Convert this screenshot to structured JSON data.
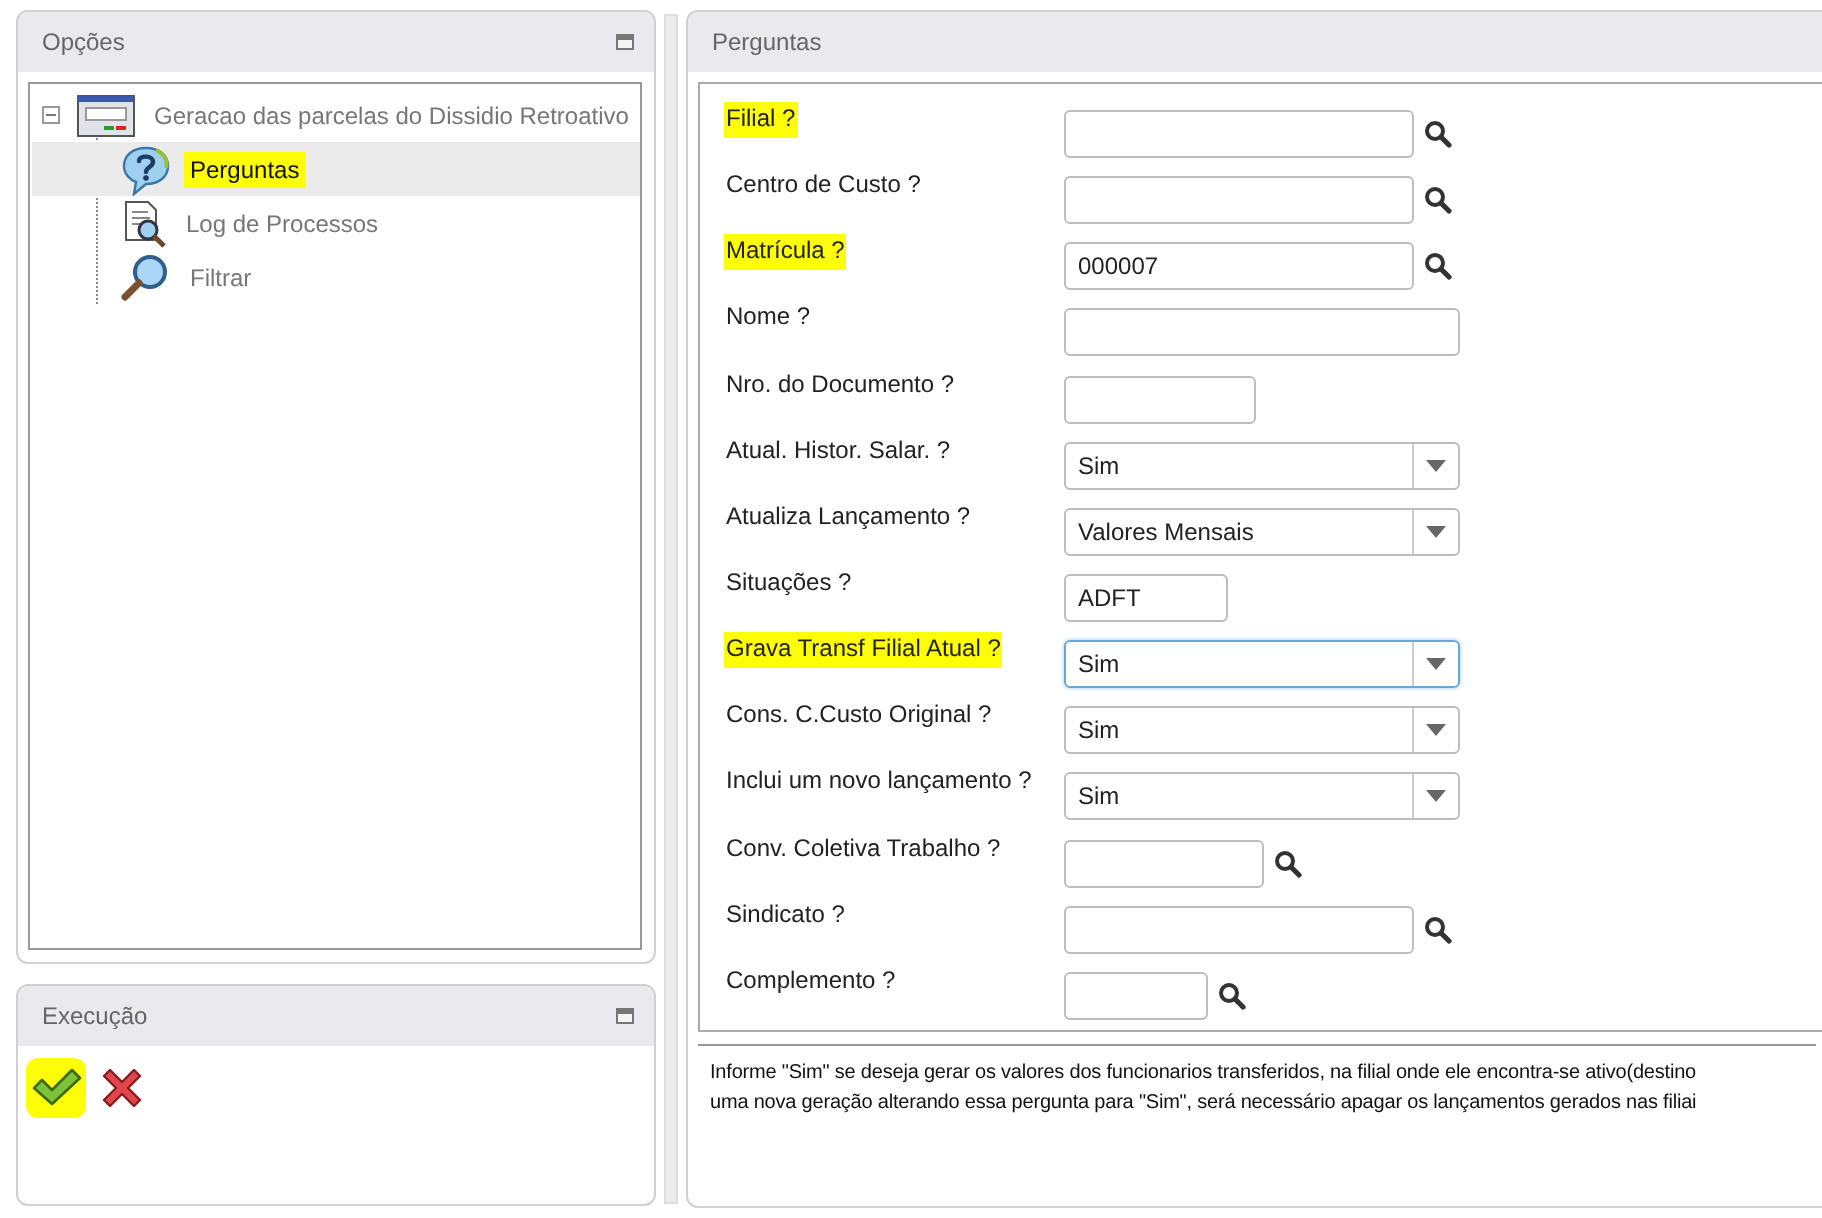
{
  "options_panel": {
    "title": "Opções",
    "tree": [
      {
        "label": "Geracao das parcelas do Dissidio Retroativo",
        "kind": "process",
        "expanded": true,
        "selected": false,
        "highlighted": false,
        "children": [
          {
            "label": "Perguntas",
            "kind": "questions",
            "selected": true,
            "highlighted": true
          },
          {
            "label": "Log de Processos",
            "kind": "log",
            "selected": false,
            "highlighted": false
          },
          {
            "label": "Filtrar",
            "kind": "filter",
            "selected": false,
            "highlighted": false
          }
        ]
      }
    ]
  },
  "execution_panel": {
    "title": "Execução",
    "buttons": [
      {
        "kind": "confirm",
        "highlighted": true
      },
      {
        "kind": "cancel",
        "highlighted": false
      }
    ]
  },
  "questions_panel": {
    "title": "Perguntas",
    "fields": [
      {
        "label": "Filial ?",
        "kind": "lookup",
        "highlighted": true,
        "focused": false
      },
      {
        "label": "Centro de Custo ?",
        "kind": "lookup",
        "highlighted": false,
        "focused": false
      },
      {
        "label": "Matrícula ?",
        "kind": "lookup",
        "value": "000007",
        "highlighted": true,
        "focused": false
      },
      {
        "label": "Nome ?",
        "kind": "text",
        "highlighted": false,
        "focused": false
      },
      {
        "label": "Nro. do Documento ?",
        "kind": "text",
        "highlighted": false,
        "focused": false
      },
      {
        "label": "Atual. Histor. Salar. ?",
        "kind": "combo",
        "value": "Sim",
        "highlighted": false,
        "focused": false
      },
      {
        "label": "Atualiza Lançamento ?",
        "kind": "combo",
        "value": "Valores Mensais",
        "highlighted": false,
        "focused": false
      },
      {
        "label": "Situações ?",
        "kind": "text",
        "value": "ADFT",
        "highlighted": false,
        "focused": false
      },
      {
        "label": "Grava Transf Filial Atual ?",
        "kind": "combo",
        "value": "Sim",
        "highlighted": true,
        "focused": true
      },
      {
        "label": "Cons. C.Custo Original ?",
        "kind": "combo",
        "value": "Sim",
        "highlighted": false,
        "focused": false
      },
      {
        "label": "Inclui um novo lançamento ?",
        "kind": "combo",
        "value": "Sim",
        "highlighted": false,
        "focused": false
      },
      {
        "label": "Conv. Coletiva Trabalho ?",
        "kind": "lookup",
        "highlighted": false,
        "focused": false
      },
      {
        "label": "Sindicato ?",
        "kind": "lookup",
        "highlighted": false,
        "focused": false
      },
      {
        "label": "Complemento ?",
        "kind": "lookup",
        "highlighted": false,
        "focused": false
      }
    ],
    "help_text": [
      "Informe \"Sim\" se deseja gerar os valores dos funcionarios transferidos, na filial onde ele encontra-se ativo(destino",
      "uma nova geração alterando essa pergunta para \"Sim\", será necessário apagar os lançamentos gerados nas filiai"
    ]
  }
}
